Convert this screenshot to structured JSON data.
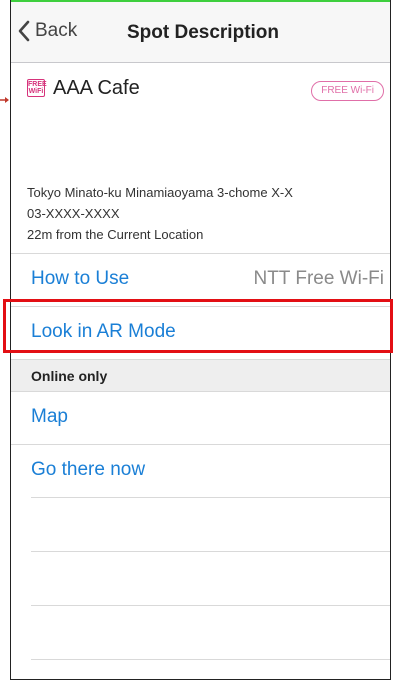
{
  "navbar": {
    "back_label": "Back",
    "title": "Spot Description"
  },
  "spot": {
    "icon": "free-wifi-icon",
    "icon_text": "FREE WiFi",
    "name": "AAA Cafe",
    "badge": "FREE Wi-Fi",
    "address": "Tokyo Minato-ku Minamiaoyama 3-chome X-X",
    "phone": "03-XXXX-XXXX",
    "distance": "22m from the Current Location"
  },
  "rows": {
    "how_to_use": {
      "label": "How to Use",
      "detail": "NTT Free Wi-Fi"
    },
    "ar_mode": {
      "label": "Look in AR Mode"
    }
  },
  "online_section": {
    "header": "Online only",
    "items": [
      {
        "label": "Map"
      },
      {
        "label": "Go there now"
      }
    ]
  },
  "colors": {
    "link_blue": "#1a7fd6",
    "highlight_red": "#e30f14",
    "brand_pink": "#d6337b",
    "status_green": "#3ecf3e"
  }
}
